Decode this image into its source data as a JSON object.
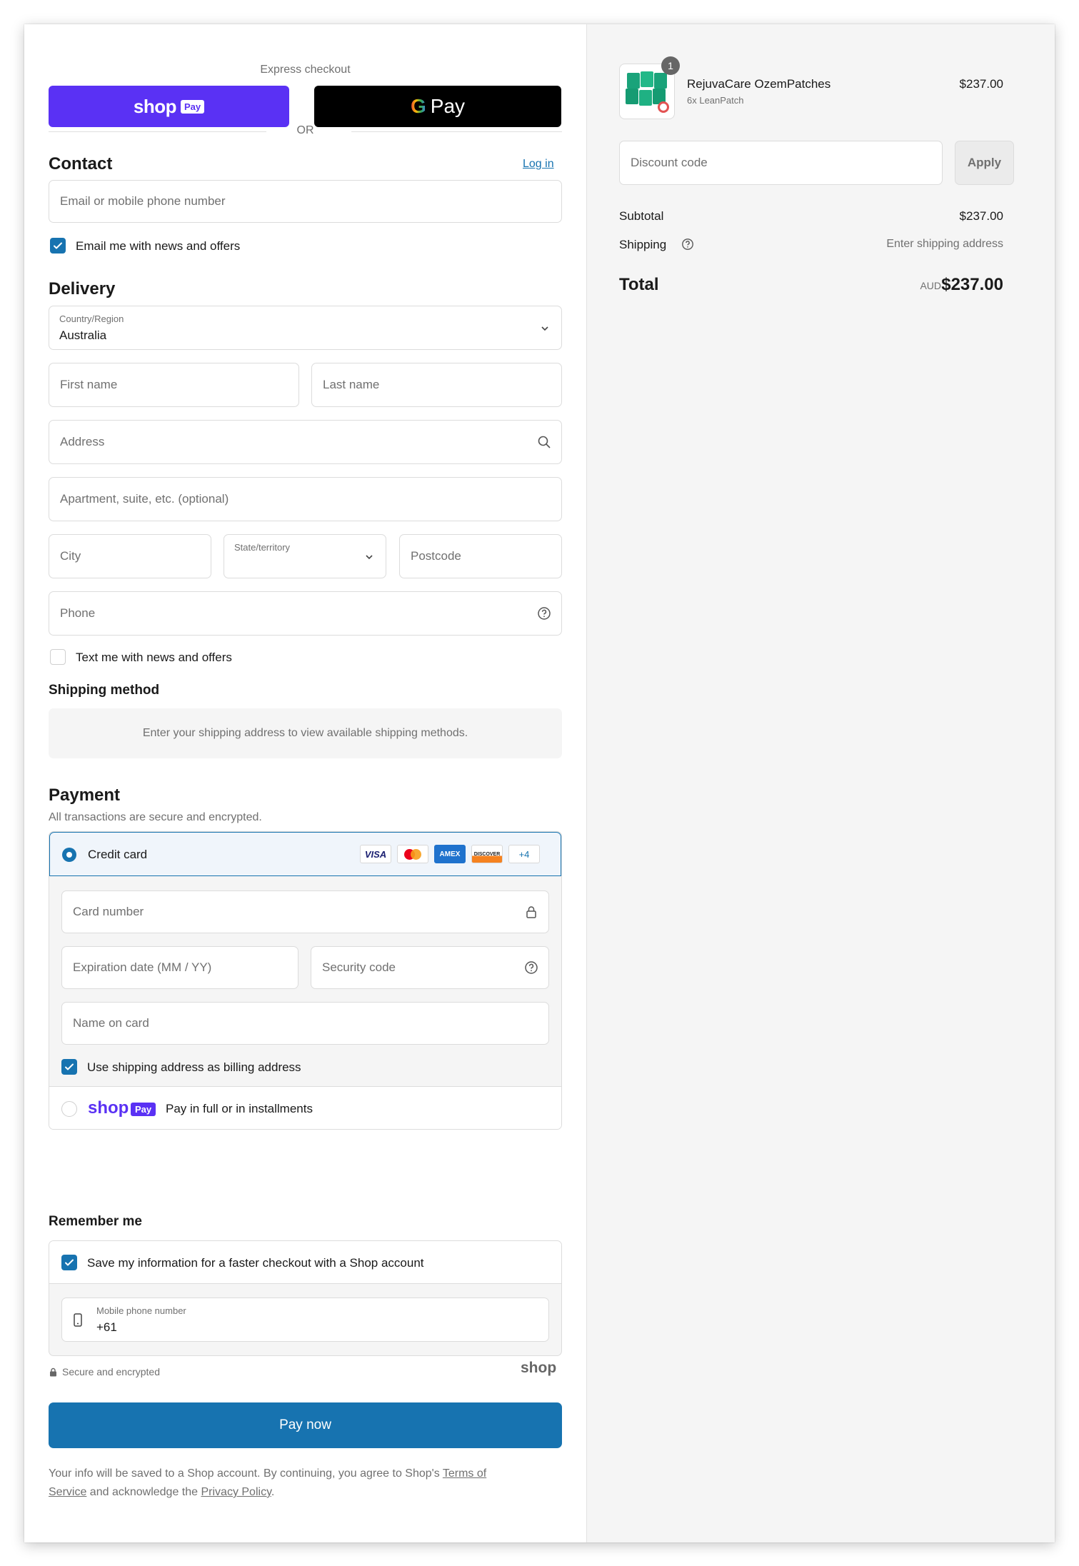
{
  "express": {
    "title": "Express checkout",
    "shop_pay_word": "shop",
    "shop_pay_badge": "Pay",
    "gpay_g": "G",
    "gpay_pay": "Pay",
    "or": "OR"
  },
  "contact": {
    "heading": "Contact",
    "login": "Log in",
    "email_placeholder": "Email or mobile phone number",
    "news_label": "Email me with news and offers"
  },
  "delivery": {
    "heading": "Delivery",
    "country_label": "Country/Region",
    "country_value": "Australia",
    "first_name": "First name",
    "last_name": "Last name",
    "address": "Address",
    "apartment": "Apartment, suite, etc. (optional)",
    "city": "City",
    "state": "State/territory",
    "postcode": "Postcode",
    "phone": "Phone",
    "text_label": "Text me with news and offers"
  },
  "shipping_method": {
    "heading": "Shipping method",
    "notice": "Enter your shipping address to view available shipping methods."
  },
  "payment": {
    "heading": "Payment",
    "subtitle": "All transactions are secure and encrypted.",
    "credit_card": "Credit card",
    "brands": {
      "visa": "VISA",
      "amex": "AMEX",
      "discover": "DISCOVER",
      "more": "+4"
    },
    "card_number": "Card number",
    "expiration": "Expiration date (MM / YY)",
    "security": "Security code",
    "name_on_card": "Name on card",
    "billing_label": "Use shipping address as billing address",
    "shop_pay_word": "shop",
    "shop_pay_badge": "Pay",
    "shop_pay_text": "Pay in full or in installments"
  },
  "remember": {
    "heading": "Remember me",
    "save_label": "Save my information for a faster checkout with a Shop account",
    "mobile_label": "Mobile phone number",
    "mobile_value": "+61",
    "secure_text": "Secure and encrypted",
    "shop_logo": "shop"
  },
  "pay_now": "Pay now",
  "legal": {
    "line1_prefix": "Your info will be saved to a Shop account. By continuing, you agree to Shop's ",
    "terms_a": "Terms of",
    "terms_b": "Service",
    "middle": " and acknowledge the ",
    "privacy": "Privacy Policy",
    "end": "."
  },
  "summary": {
    "product_name": "RejuvaCare OzemPatches",
    "product_variant": "6x LeanPatch",
    "product_price": "$237.00",
    "quantity": "1",
    "discount_placeholder": "Discount code",
    "apply": "Apply",
    "subtotal_label": "Subtotal",
    "subtotal_value": "$237.00",
    "shipping_label": "Shipping",
    "shipping_value": "Enter shipping address",
    "total_label": "Total",
    "currency": "AUD",
    "total_value": "$237.00"
  },
  "colors": {
    "accent": "#1773b0",
    "shop_purple": "#5a31f4",
    "panel_bg": "#f5f5f5"
  }
}
